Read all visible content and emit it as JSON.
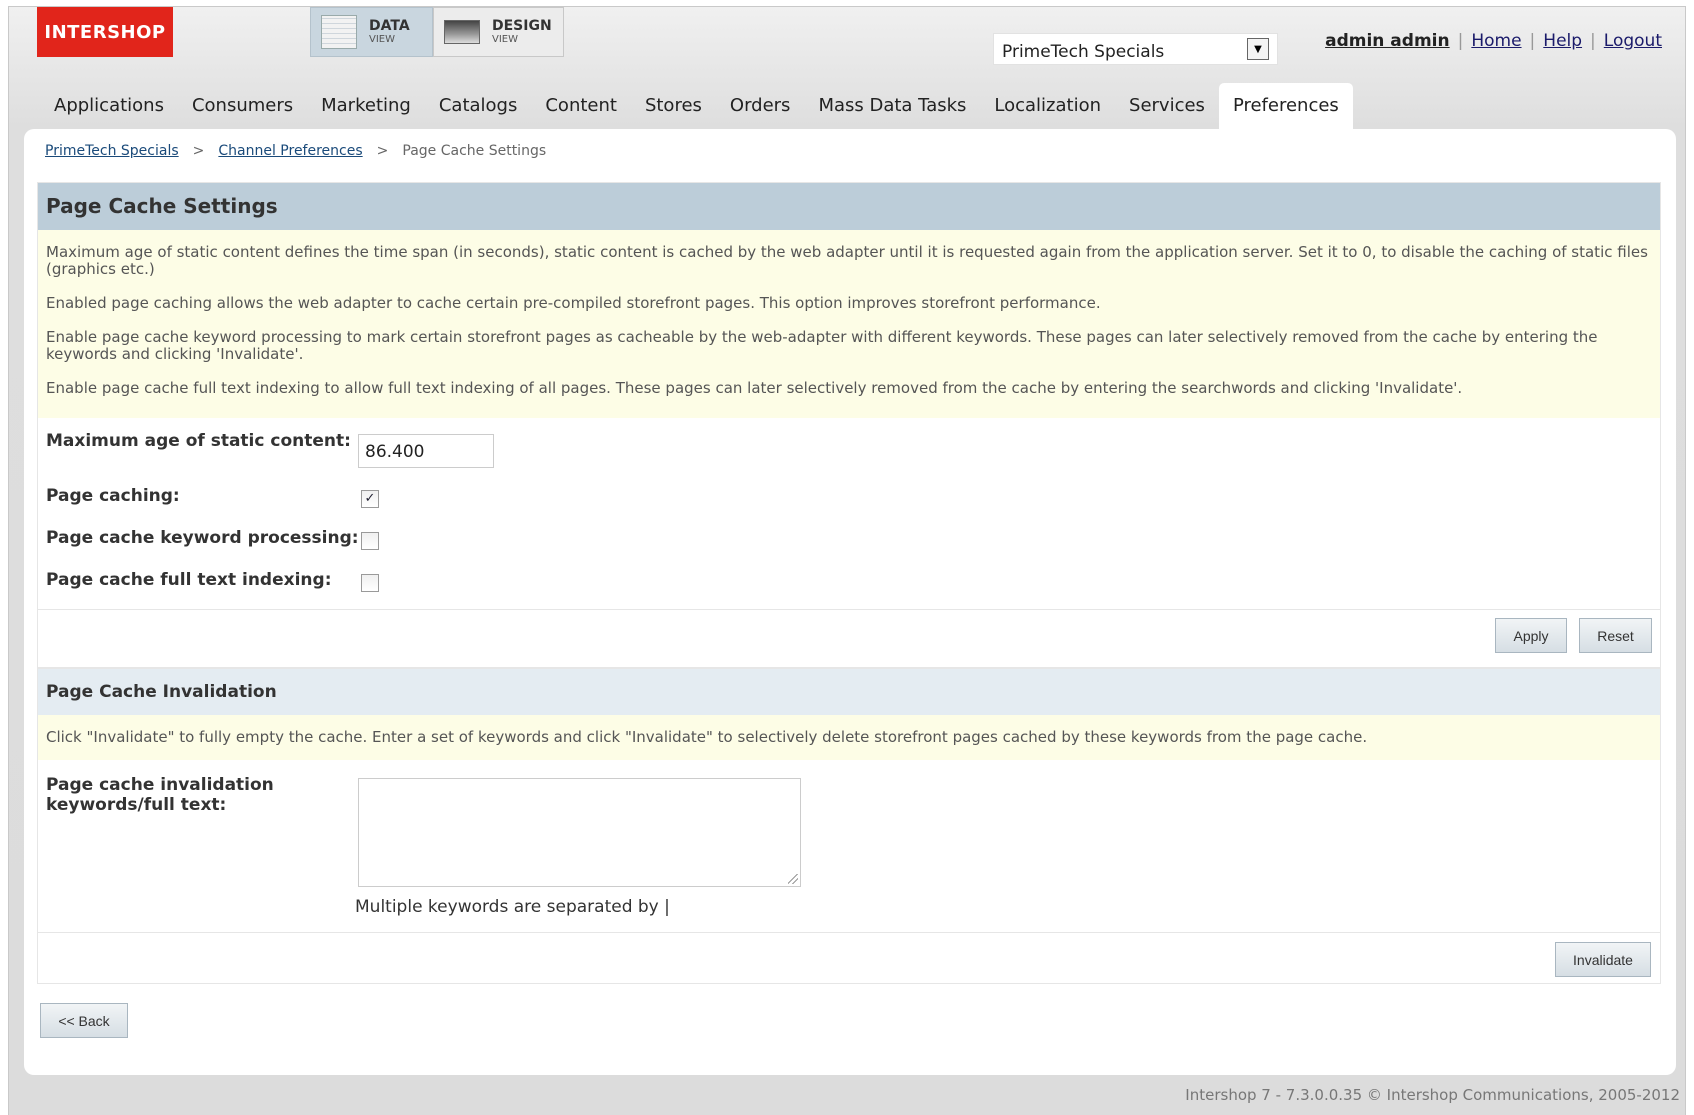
{
  "header": {
    "logo_text": "INTERSHOP",
    "data_view": {
      "title": "DATA",
      "subtitle": "VIEW"
    },
    "design_view": {
      "title": "DESIGN",
      "subtitle": "VIEW"
    },
    "channel_select": {
      "value": "PrimeTech Specials"
    },
    "user_link": "admin admin",
    "home_link": "Home",
    "help_link": "Help",
    "logout_link": "Logout",
    "separator": "|"
  },
  "nav": {
    "items": [
      "Applications",
      "Consumers",
      "Marketing",
      "Catalogs",
      "Content",
      "Stores",
      "Orders",
      "Mass Data Tasks",
      "Localization",
      "Services",
      "Preferences"
    ],
    "active": "Preferences"
  },
  "breadcrumb": {
    "items": [
      "PrimeTech Specials",
      "Channel Preferences",
      "Page Cache Settings"
    ],
    "separator": ">"
  },
  "settings": {
    "title": "Page Cache Settings",
    "info": [
      "Maximum age of static content defines the time span (in seconds), static content is cached by the web adapter until it is requested again from the application server. Set it to 0, to disable the caching of static files (graphics etc.)",
      "Enabled page caching allows the web adapter to cache certain pre-compiled storefront pages. This option improves storefront performance.",
      "Enable page cache keyword processing to mark certain storefront pages as cacheable by the web-adapter with different keywords. These pages can later selectively removed from the cache by entering the keywords and clicking 'Invalidate'.",
      "Enable page cache full text indexing to allow full text indexing of all pages. These pages can later selectively removed from the cache by entering the searchwords and clicking 'Invalidate'."
    ],
    "max_age_label": "Maximum age of static content:",
    "max_age_value": "86.400",
    "page_caching_label": "Page caching:",
    "page_caching_checked": true,
    "keyword_label": "Page cache keyword processing:",
    "keyword_checked": false,
    "fulltext_label": "Page cache full text indexing:",
    "fulltext_checked": false,
    "apply_label": "Apply",
    "reset_label": "Reset"
  },
  "invalidation": {
    "title": "Page Cache Invalidation",
    "info": "Click \"Invalidate\" to fully empty the cache. Enter a set of keywords and click \"Invalidate\" to selectively delete storefront pages cached by these keywords from the page cache.",
    "field_label_1": "Page cache invalidation",
    "field_label_2": "keywords/full text:",
    "keywords_value": "",
    "hint": "Multiple keywords are separated by |",
    "invalidate_label": "Invalidate"
  },
  "back_label": "<< Back",
  "footer": "Intershop 7 - 7.3.0.0.35 © Intershop Communications, 2005-2012",
  "colors": {
    "logo_red": "#e1251b",
    "header_blue": "#bccdd9",
    "info_yellow": "#fdfde6"
  },
  "icons": {
    "dropdown": "chevron-down-icon",
    "checkbox_check": "check-icon"
  }
}
